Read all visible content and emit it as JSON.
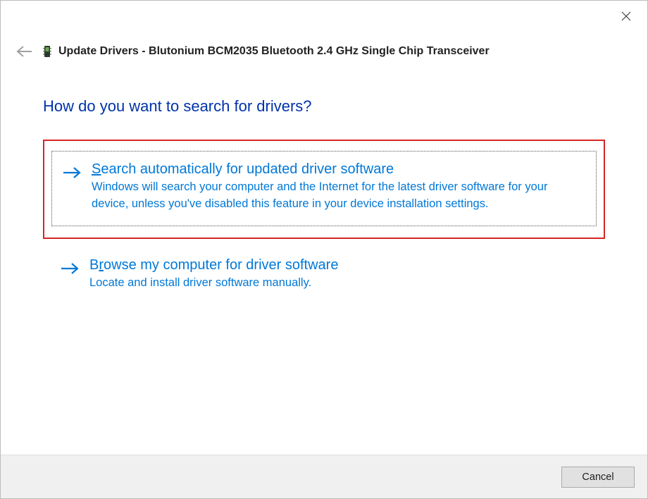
{
  "window": {
    "title": "Update Drivers - Blutonium BCM2035 Bluetooth 2.4 GHz Single Chip Transceiver"
  },
  "question": "How do you want to search for drivers?",
  "options": {
    "auto": {
      "title_prefix": "S",
      "title_rest": "earch automatically for updated driver software",
      "desc": "Windows will search your computer and the Internet for the latest driver software for your device, unless you've disabled this feature in your device installation settings."
    },
    "browse": {
      "title_prefix": "B",
      "title_middle": "",
      "title_underline": "r",
      "title_rest": "owse my computer for driver software",
      "desc": "Locate and install driver software manually."
    }
  },
  "footer": {
    "cancel": "Cancel"
  }
}
